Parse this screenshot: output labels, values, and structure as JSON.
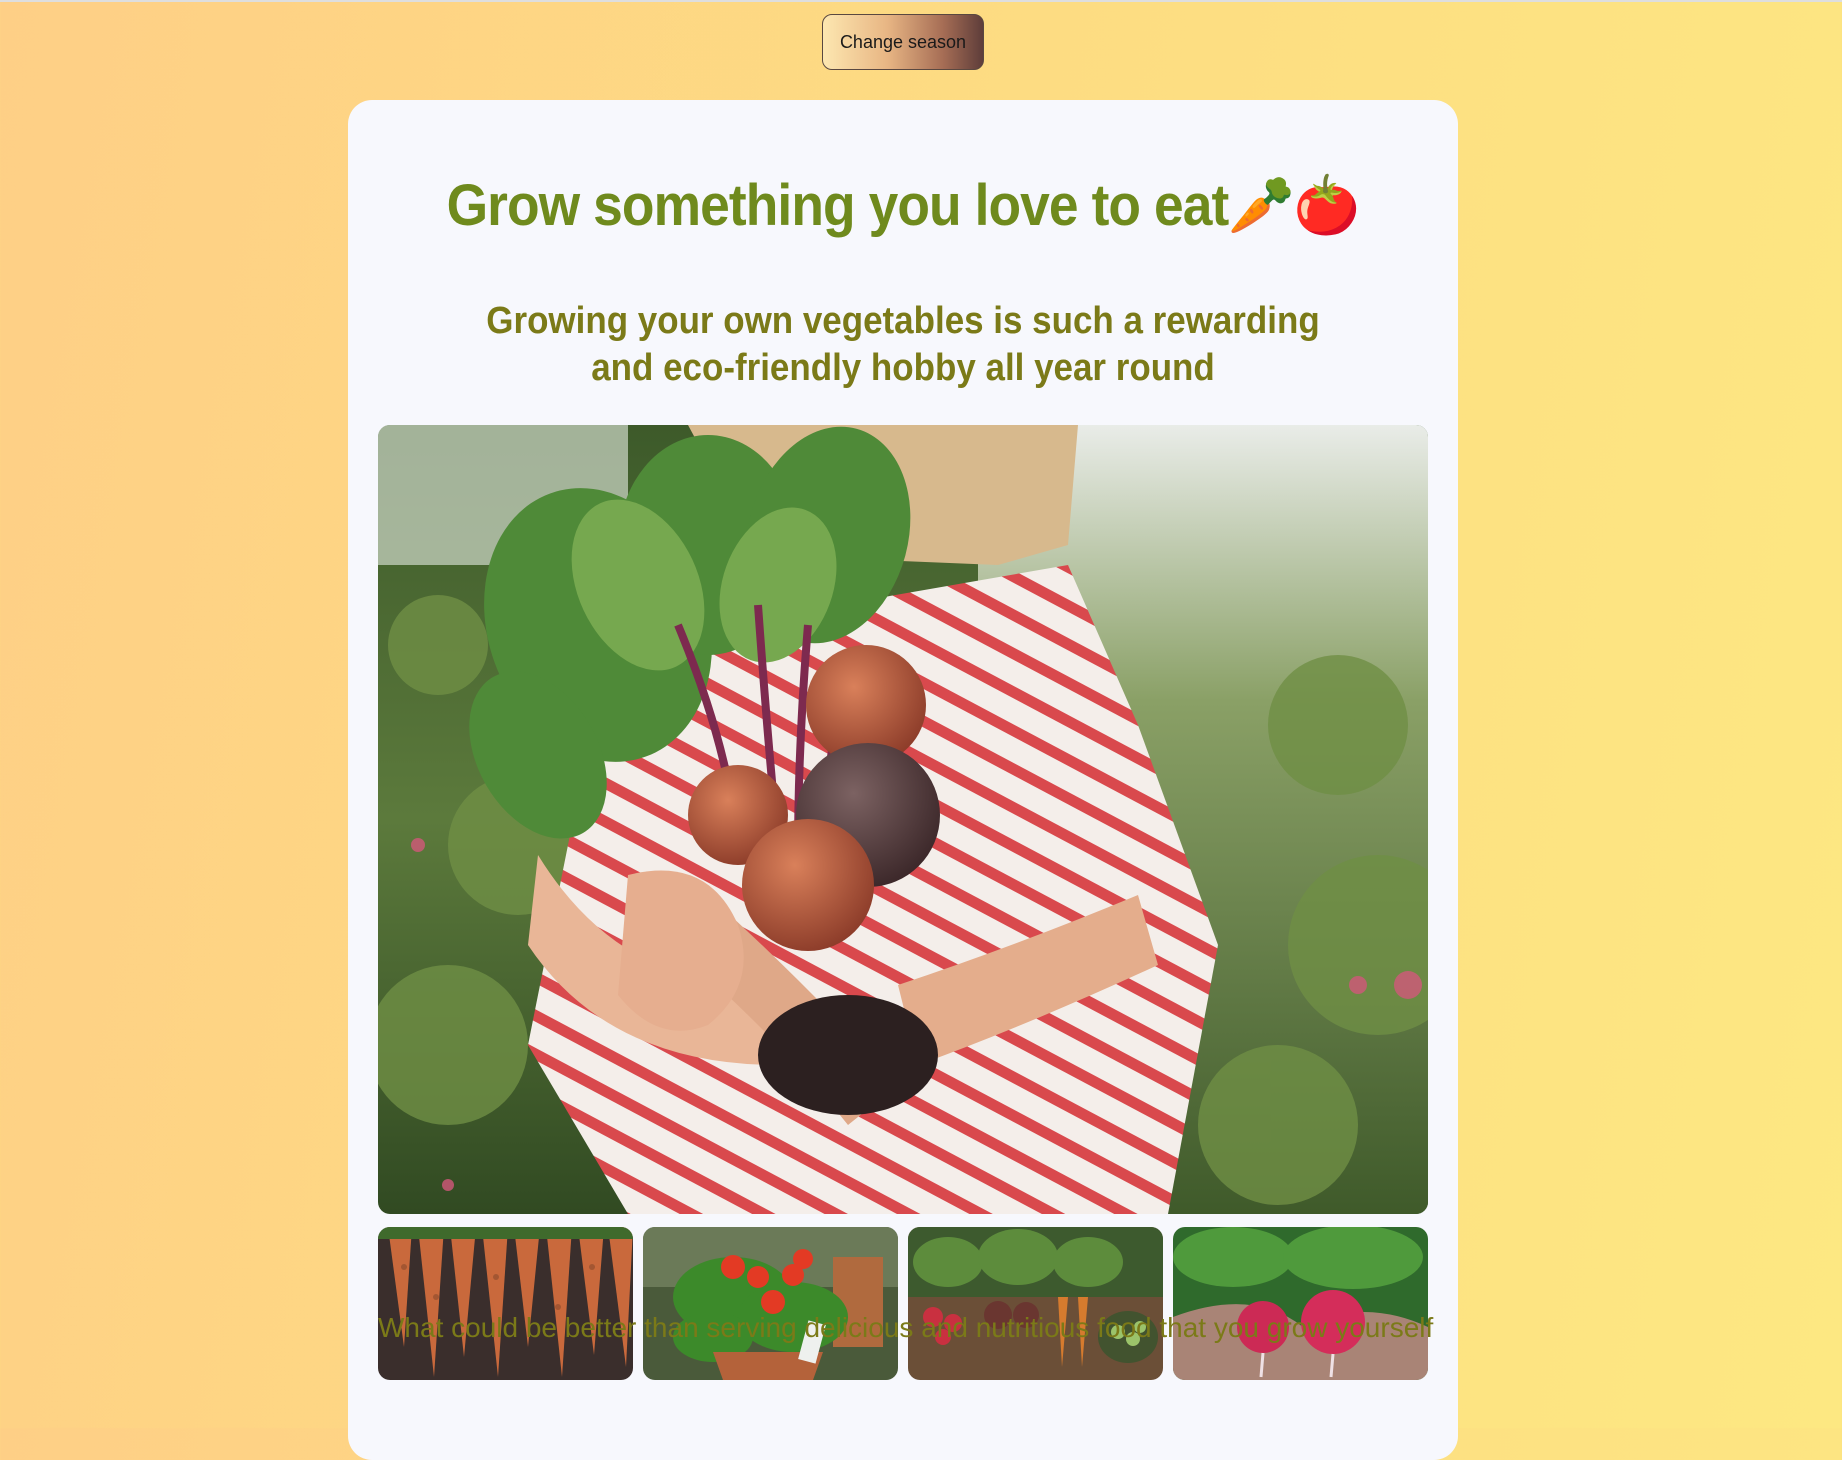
{
  "controls": {
    "change_season_label": "Change season"
  },
  "article": {
    "title": "Grow something you love to eat🥕🍅",
    "subtitle": "Growing your own vegetables is such a rewarding and eco-friendly hobby all year round",
    "body_intro": "What could be better than serving delicious and nutritious food that you grow yourself"
  },
  "images": {
    "hero": "person holding freshly harvested beetroots in a garden",
    "thumbnails": [
      "carrots",
      "cherry tomato plant",
      "root vegetables in soil",
      "radishes in hands"
    ]
  },
  "colors": {
    "title": "#6f8a1d",
    "subtitle": "#7b7a18",
    "card_background": "#f7f8fd",
    "page_gradient_start": "#fecf86",
    "page_gradient_end": "#fde882"
  }
}
